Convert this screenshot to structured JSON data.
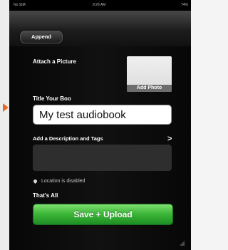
{
  "statusbar": {
    "carrier": "No SIM",
    "time": "9:26 AM",
    "battery": "74%"
  },
  "navbar": {
    "append_label": "Append"
  },
  "form": {
    "attach_picture_label": "Attach a Picture",
    "add_photo_label": "Add Photo",
    "title_label": "Title Your Boo",
    "title_value": "My test audiobook",
    "description_label": "Add a Description and Tags",
    "description_chevron": ">",
    "location_text": "Location is disabled",
    "thats_all_label": "That's All",
    "save_upload_label": "Save + Upload"
  },
  "colors": {
    "accent_arrow": "#e7692a",
    "save_green": "#3eb83a",
    "background_dark": "#0b0b0b"
  },
  "icons": {
    "location": "location-pin-icon",
    "chevron": "chevron-right-icon",
    "arrow": "arrow-right-icon"
  }
}
